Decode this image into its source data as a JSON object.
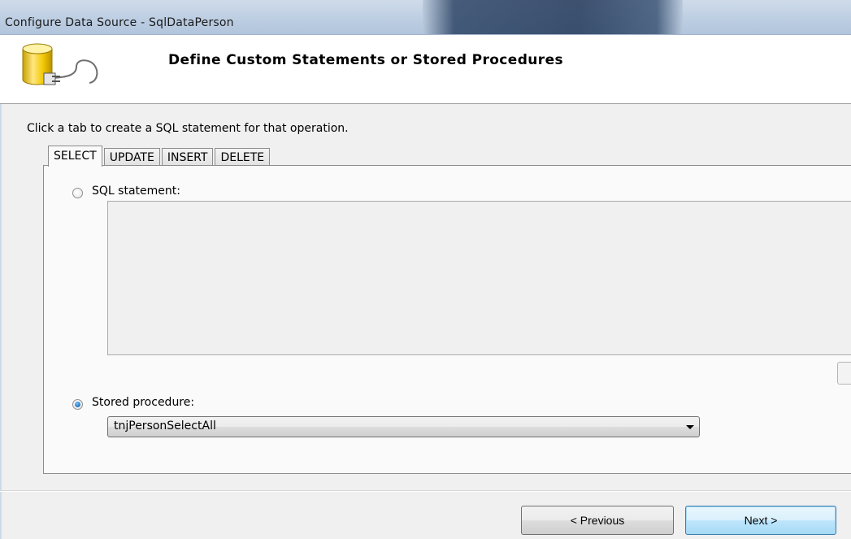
{
  "window": {
    "title": "Configure Data Source - SqlDataPerson"
  },
  "header": {
    "title": "Define Custom Statements or Stored Procedures",
    "icon": "database-plug-icon"
  },
  "body": {
    "instruction": "Click a tab to create a SQL statement for that operation.",
    "tabs": [
      {
        "label": "SELECT",
        "active": true
      },
      {
        "label": "UPDATE",
        "active": false
      },
      {
        "label": "INSERT",
        "active": false
      },
      {
        "label": "DELETE",
        "active": false
      }
    ],
    "sql_statement": {
      "label": "SQL statement:",
      "selected": false,
      "value": ""
    },
    "stored_procedure": {
      "label": "Stored procedure:",
      "selected": true,
      "value": "tnjPersonSelectAll"
    }
  },
  "footer": {
    "previous_label": "< Previous",
    "next_label": "Next >"
  },
  "colors": {
    "titlebar": "#bccde2",
    "header_bg": "#ffffff",
    "panel_bg": "#fafafa",
    "default_button_border": "#3c7fb1",
    "radio_selected": "#1a72c4"
  }
}
